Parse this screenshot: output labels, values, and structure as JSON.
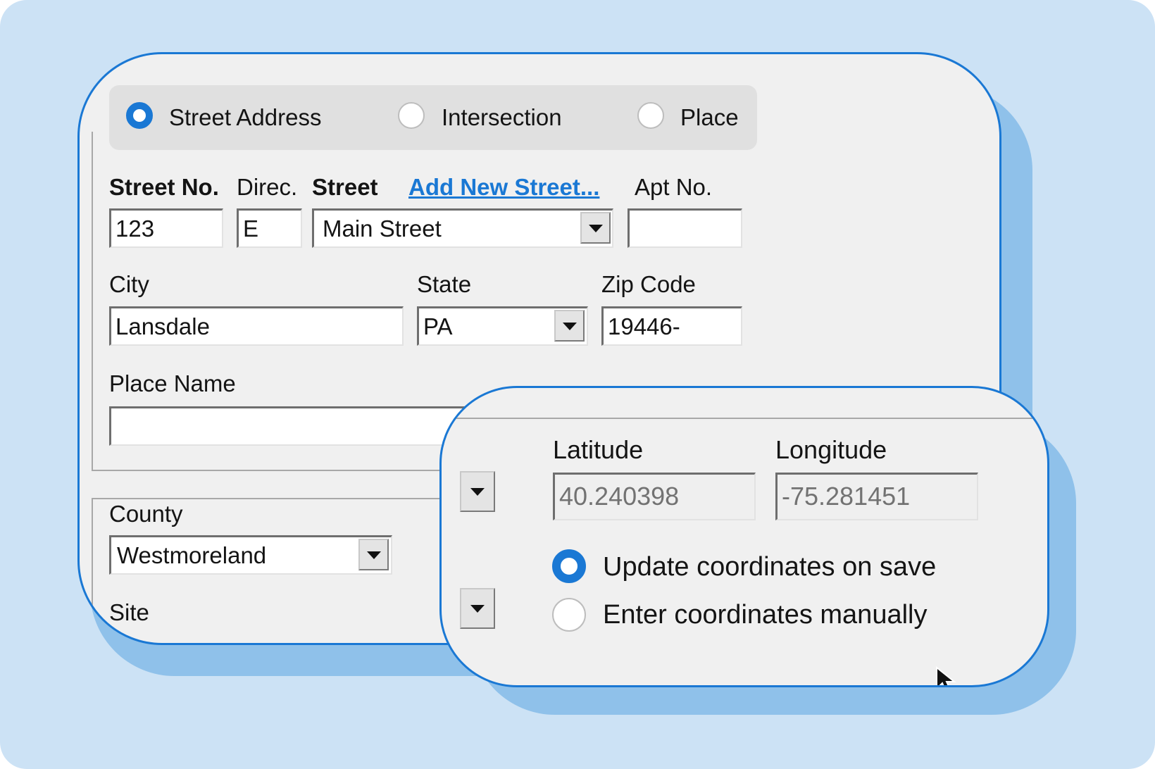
{
  "address_type": {
    "options": [
      {
        "label": "Street Address",
        "selected": true
      },
      {
        "label": "Intersection",
        "selected": false
      },
      {
        "label": "Place",
        "selected": false
      }
    ]
  },
  "street": {
    "street_no_label": "Street No.",
    "direc_label": "Direc.",
    "street_label": "Street",
    "add_new_street_link": "Add New Street...",
    "apt_no_label": "Apt No.",
    "street_no_value": "123",
    "direc_value": "E",
    "street_value": "Main Street",
    "apt_no_value": ""
  },
  "location": {
    "city_label": "City",
    "city_value": "Lansdale",
    "state_label": "State",
    "state_value": "PA",
    "zip_label": "Zip Code",
    "zip_value": "19446-"
  },
  "place": {
    "place_name_label": "Place Name",
    "place_name_value": ""
  },
  "county": {
    "county_label": "County",
    "county_value": "Westmoreland",
    "site_label": "Site"
  },
  "coordinates": {
    "latitude_label": "Latitude",
    "latitude_value": "40.240398",
    "longitude_label": "Longitude",
    "longitude_value": "-75.281451",
    "options": [
      {
        "label": "Update coordinates on save",
        "selected": true
      },
      {
        "label": "Enter coordinates manually",
        "selected": false
      }
    ]
  },
  "colors": {
    "accent": "#1a78d4",
    "background": "#cce2f5",
    "shadow": "#8fc1ea",
    "panel": "#f0f0f0"
  }
}
